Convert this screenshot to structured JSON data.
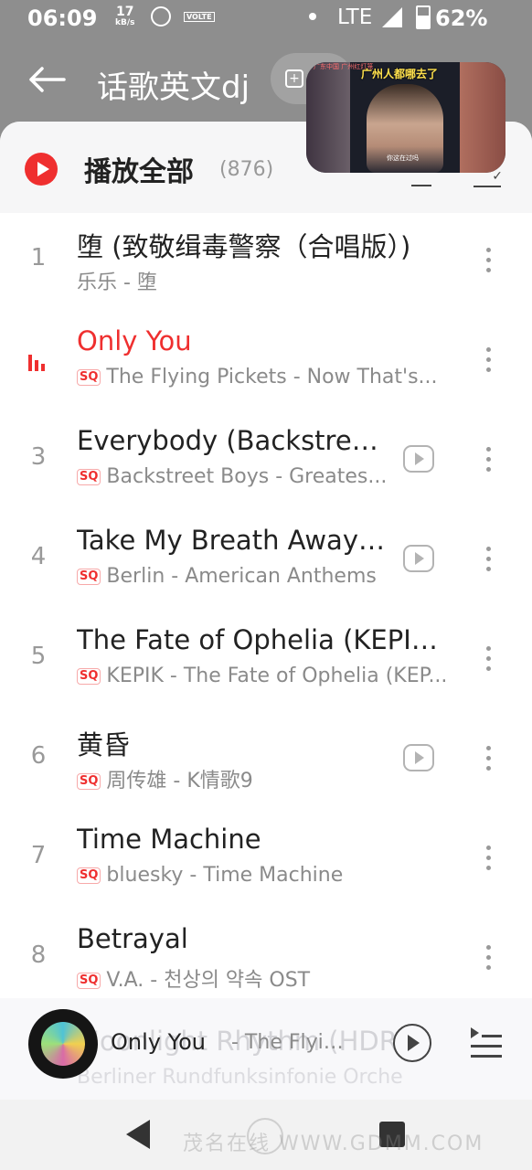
{
  "status_bar": {
    "time": "06:09",
    "net_speed": "17",
    "net_unit": "kB/s",
    "volte": "VOLTE",
    "network": "LTE",
    "battery": "62%"
  },
  "header": {
    "title": "话歌英文dj"
  },
  "pip": {
    "caption": "广州人都哪去了",
    "top_text": "广东中国 广州红灯笼",
    "bottom_text": "你这在过吗"
  },
  "play_all": {
    "label": "播放全部",
    "count": "(876)"
  },
  "songs": [
    {
      "index": "1",
      "title": "堕 (致敬缉毒警察（合唱版）)",
      "artist_album": "乐乐 - 堕",
      "sq": "",
      "has_mv": false,
      "playing": false
    },
    {
      "index": "",
      "title": "Only You",
      "artist_album": "The Flying Pickets - Now That's...",
      "sq": "SQ",
      "has_mv": false,
      "playing": true
    },
    {
      "index": "3",
      "title": "Everybody (Backstreet'...",
      "artist_album": "Backstreet Boys - Greates...",
      "sq": "SQ",
      "has_mv": true,
      "playing": false
    },
    {
      "index": "4",
      "title": "Take My Breath Away (...",
      "artist_album": "Berlin - American Anthems",
      "sq": "SQ",
      "has_mv": true,
      "playing": false
    },
    {
      "index": "5",
      "title": "The Fate of Ophelia (KEPIK...",
      "artist_album": "KEPIK - The Fate of Ophelia (KEP...",
      "sq": "SQ",
      "has_mv": false,
      "playing": false
    },
    {
      "index": "6",
      "title": "黄昏",
      "artist_album": "周传雄 - K情歌9",
      "sq": "SQ",
      "has_mv": true,
      "playing": false
    },
    {
      "index": "7",
      "title": "Time Machine",
      "artist_album": "bluesky - Time Machine",
      "sq": "SQ",
      "has_mv": false,
      "playing": false
    },
    {
      "index": "8",
      "title": "Betrayal",
      "artist_album": "V.A. - 천상의 약속 OST",
      "sq": "SQ",
      "has_mv": false,
      "playing": false
    }
  ],
  "mini_player": {
    "title": "Only You",
    "artist": "- The Flying Pickets",
    "under_title": "Moonlight Rhythm (HDR",
    "under_sub": "Berliner Rundfunksinfonie Orche"
  },
  "nav": {
    "watermark": "茂名在线 WWW.GDMM.COM"
  },
  "colors": {
    "accent": "#ef2f2f",
    "sheet_bg": "#ffffff",
    "dimmed_bg": "#8e8e8e"
  }
}
